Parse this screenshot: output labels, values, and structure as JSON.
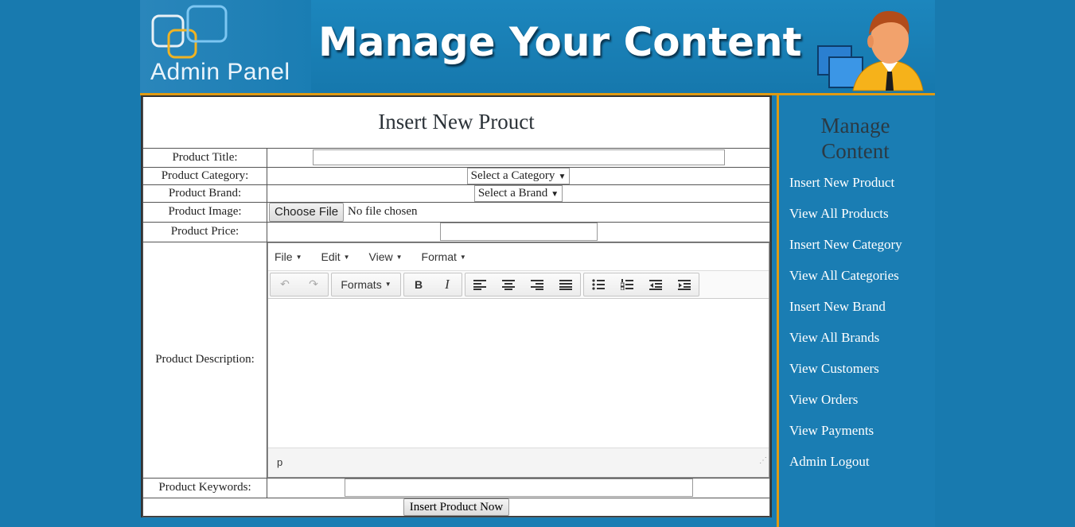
{
  "header": {
    "logo_text": "Admin Panel",
    "banner": "Manage Your Content"
  },
  "form": {
    "heading": "Insert New Prouct",
    "title_label": "Product Title:",
    "title_value": "",
    "category_label": "Product Category:",
    "category_selected": "Select a Category",
    "brand_label": "Product Brand:",
    "brand_selected": "Select a Brand",
    "image_label": "Product Image:",
    "choose_file": "Choose File",
    "no_file": "No file chosen",
    "price_label": "Product Price:",
    "price_value": "",
    "description_label": "Product Description:",
    "keywords_label": "Product Keywords:",
    "keywords_value": "",
    "submit": "Insert Product Now"
  },
  "editor": {
    "menus": [
      "File",
      "Edit",
      "View",
      "Format"
    ],
    "formats_label": "Formats",
    "bold": "B",
    "italic": "I",
    "status_path": "p"
  },
  "sidebar": {
    "title": "Manage Content",
    "items": [
      "Insert New Product",
      "View All Products",
      "Insert New Category",
      "View All Categories",
      "Insert New Brand",
      "View All Brands",
      "View Customers",
      "View Orders",
      "View Payments",
      "Admin Logout"
    ]
  },
  "colors": {
    "background": "#187aaf",
    "accent_border": "#e09a12",
    "link": "#ffffff"
  }
}
